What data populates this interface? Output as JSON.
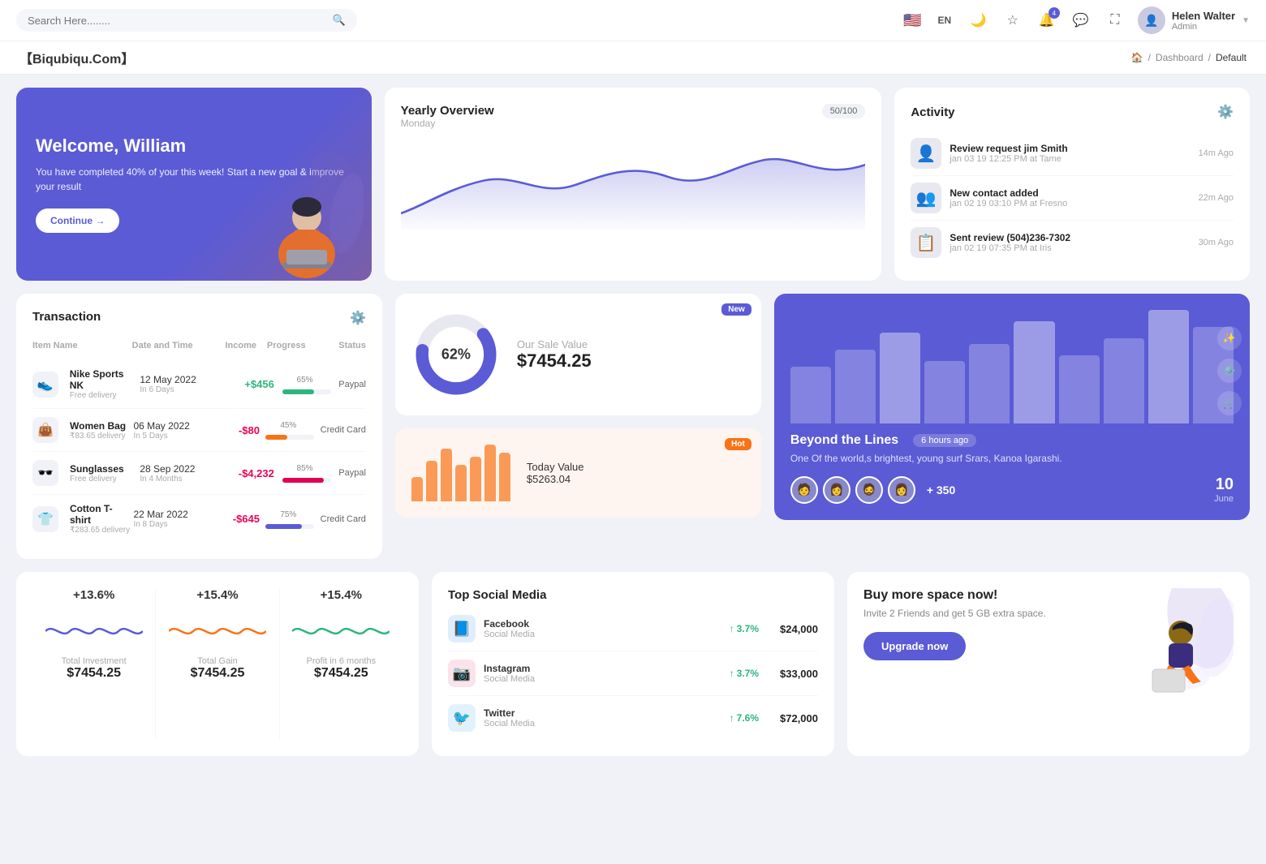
{
  "topnav": {
    "search_placeholder": "Search Here........",
    "lang": "EN",
    "notification_count": "4",
    "user_name": "Helen Walter",
    "user_role": "Admin"
  },
  "breadcrumb": {
    "brand": "【Biqubiqu.Com】",
    "home": "🏠",
    "separator": "/",
    "dashboard": "Dashboard",
    "default": "Default"
  },
  "welcome": {
    "title": "Welcome, William",
    "subtitle": "You have completed 40% of your this week! Start a new goal & improve your result",
    "button": "Continue →"
  },
  "yearly_overview": {
    "title": "Yearly Overview",
    "day": "Monday",
    "badge": "50/100"
  },
  "activity": {
    "title": "Activity",
    "items": [
      {
        "name": "Review request jim Smith",
        "sub": "jan 03 19 12:25 PM at Tame",
        "time": "14m Ago",
        "emoji": "👤"
      },
      {
        "name": "New contact added",
        "sub": "jan 02 19 03:10 PM at Fresno",
        "time": "22m Ago",
        "emoji": "👥"
      },
      {
        "name": "Sent review (504)236-7302",
        "sub": "jan 02 19 07:35 PM at Iris",
        "time": "30m Ago",
        "emoji": "📋"
      }
    ]
  },
  "transaction": {
    "title": "Transaction",
    "headers": {
      "item": "Item Name",
      "date": "Date and Time",
      "income": "Income",
      "progress": "Progress",
      "status": "Status"
    },
    "rows": [
      {
        "icon": "👟",
        "name": "Nike Sports NK",
        "sub": "Free delivery",
        "date": "12 May 2022",
        "days": "In 6 Days",
        "income": "+$456",
        "income_type": "pos",
        "progress": 65,
        "progress_color": "green",
        "status": "Paypal"
      },
      {
        "icon": "👜",
        "name": "Women Bag",
        "sub": "₹83.65 delivery",
        "date": "06 May 2022",
        "days": "In 5 Days",
        "income": "-$80",
        "income_type": "neg",
        "progress": 45,
        "progress_color": "orange",
        "status": "Credit Card"
      },
      {
        "icon": "🕶️",
        "name": "Sunglasses",
        "sub": "Free delivery",
        "date": "28 Sep 2022",
        "days": "In 4 Months",
        "income": "-$4,232",
        "income_type": "neg",
        "progress": 85,
        "progress_color": "red",
        "status": "Paypal"
      },
      {
        "icon": "👕",
        "name": "Cotton T-shirt",
        "sub": "₹283.65 delivery",
        "date": "22 Mar 2022",
        "days": "In 8 Days",
        "income": "-$645",
        "income_type": "neg",
        "progress": 75,
        "progress_color": "blue",
        "status": "Credit Card"
      }
    ]
  },
  "sale_value": {
    "badge": "New",
    "donut_pct": "62%",
    "label": "Our Sale Value",
    "value": "$7454.25"
  },
  "today_value": {
    "badge": "Hot",
    "label": "Today Value",
    "value": "$5263.04",
    "bars": [
      30,
      50,
      65,
      45,
      55,
      70,
      60
    ]
  },
  "beyond": {
    "title": "Beyond the Lines",
    "time_ago": "6 hours ago",
    "desc": "One Of the world,s brightest, young surf Srars, Kanoa Igarashi.",
    "extra_count": "+ 350",
    "date": "10",
    "month": "June",
    "avatars": [
      "🧑",
      "👩",
      "🧔",
      "👩‍🦱"
    ]
  },
  "stats": [
    {
      "pct": "+13.6%",
      "label": "Total Investment",
      "value": "$7454.25",
      "color": "#5b5bd6",
      "wave_id": "wave1"
    },
    {
      "pct": "+15.4%",
      "label": "Total Gain",
      "value": "$7454.25",
      "color": "#f97316",
      "wave_id": "wave2"
    },
    {
      "pct": "+15.4%",
      "label": "Profit in 6 months",
      "value": "$7454.25",
      "color": "#2cb67d",
      "wave_id": "wave3"
    }
  ],
  "social": {
    "title": "Top Social Media",
    "items": [
      {
        "name": "Facebook",
        "type": "Social Media",
        "pct": "3.7%",
        "amount": "$24,000",
        "color": "#1877f2",
        "emoji": "📘"
      },
      {
        "name": "Instagram",
        "type": "Social Media",
        "pct": "3.7%",
        "amount": "$33,000",
        "color": "#e1306c",
        "emoji": "📷"
      },
      {
        "name": "Twitter",
        "type": "Social Media",
        "pct": "7.6%",
        "amount": "$72,000",
        "color": "#1da1f2",
        "emoji": "🐦"
      }
    ]
  },
  "buy_space": {
    "title": "Buy more space now!",
    "sub": "Invite 2 Friends and get 5 GB extra space.",
    "button": "Upgrade now"
  }
}
